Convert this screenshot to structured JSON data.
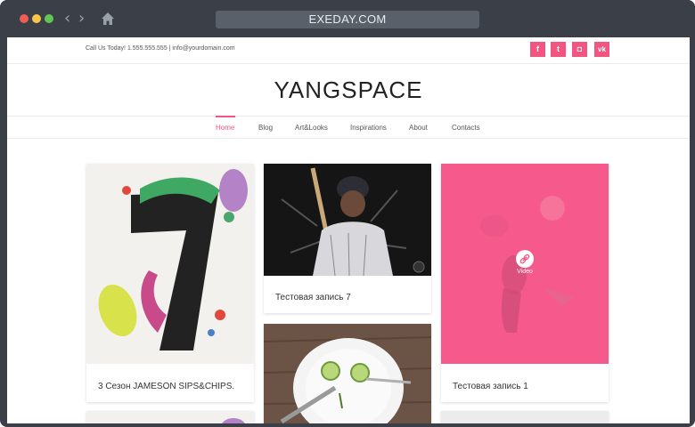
{
  "browser": {
    "url": "EXEDAY.COM",
    "back_icon": "‹",
    "forward_icon": "›",
    "icons": [
      "back-icon",
      "forward-icon",
      "home-icon"
    ]
  },
  "topbar": {
    "contact_text": "Call Us Today! 1.555.555.555  |  info@yourdomain.com",
    "social": [
      {
        "name": "facebook-icon",
        "glyph": "f"
      },
      {
        "name": "twitter-icon",
        "glyph": "t"
      },
      {
        "name": "instagram-icon",
        "glyph": "◘"
      },
      {
        "name": "vk-icon",
        "glyph": "vk"
      }
    ],
    "accent_color": "#f2557f"
  },
  "site": {
    "logo": "YANGSPACE"
  },
  "menu": {
    "items": [
      "Home",
      "Blog",
      "Art&Looks",
      "Inspirations",
      "About",
      "Contacts"
    ],
    "active": "Home"
  },
  "posts": [
    {
      "title": "3 Сезон JAMESON SIPS&CHIPS."
    },
    {
      "title": "Тестовая запись 7"
    },
    {
      "title": "Тестовая запись 1",
      "badge": "Video",
      "overlay_color": "#f65a8c"
    }
  ]
}
